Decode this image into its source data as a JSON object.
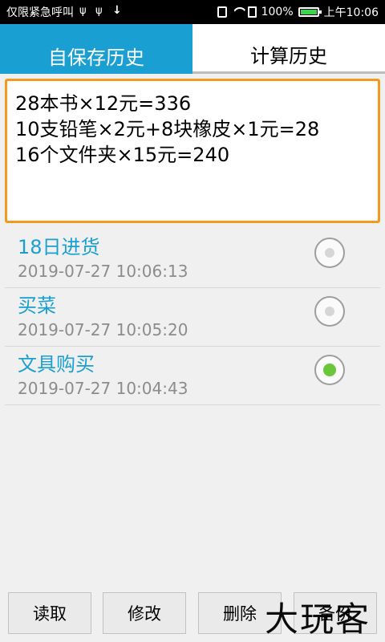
{
  "statusbar": {
    "left_text": "仅限紧急呼叫",
    "battery_percent": "100%",
    "time": "上午10:06",
    "icons": [
      "usb-icon",
      "usb-icon",
      "download-icon",
      "vibrate-icon",
      "wifi-icon",
      "sim-icon",
      "battery-icon"
    ]
  },
  "tabs": {
    "saved_history": "自保存历史",
    "calc_history": "计算历史",
    "active": "saved_history"
  },
  "content": {
    "lines": [
      "28本书×12元=336",
      "10支铅笔×2元+8块橡皮×1元=28",
      "16个文件夹×15元=240"
    ]
  },
  "list": {
    "items": [
      {
        "title": "18日进货",
        "time": "2019-07-27 10:06:13",
        "selected": false
      },
      {
        "title": "买菜",
        "time": "2019-07-27 10:05:20",
        "selected": false
      },
      {
        "title": "文具购买",
        "time": "2019-07-27 10:04:43",
        "selected": true
      }
    ]
  },
  "buttons": {
    "read": "读取",
    "edit": "修改",
    "delete": "删除",
    "backup": "备份"
  },
  "watermark": "大玩客",
  "colors": {
    "accent": "#1a9fd3",
    "textarea_border": "#f39a1e",
    "radio_checked": "#6ac73a"
  }
}
